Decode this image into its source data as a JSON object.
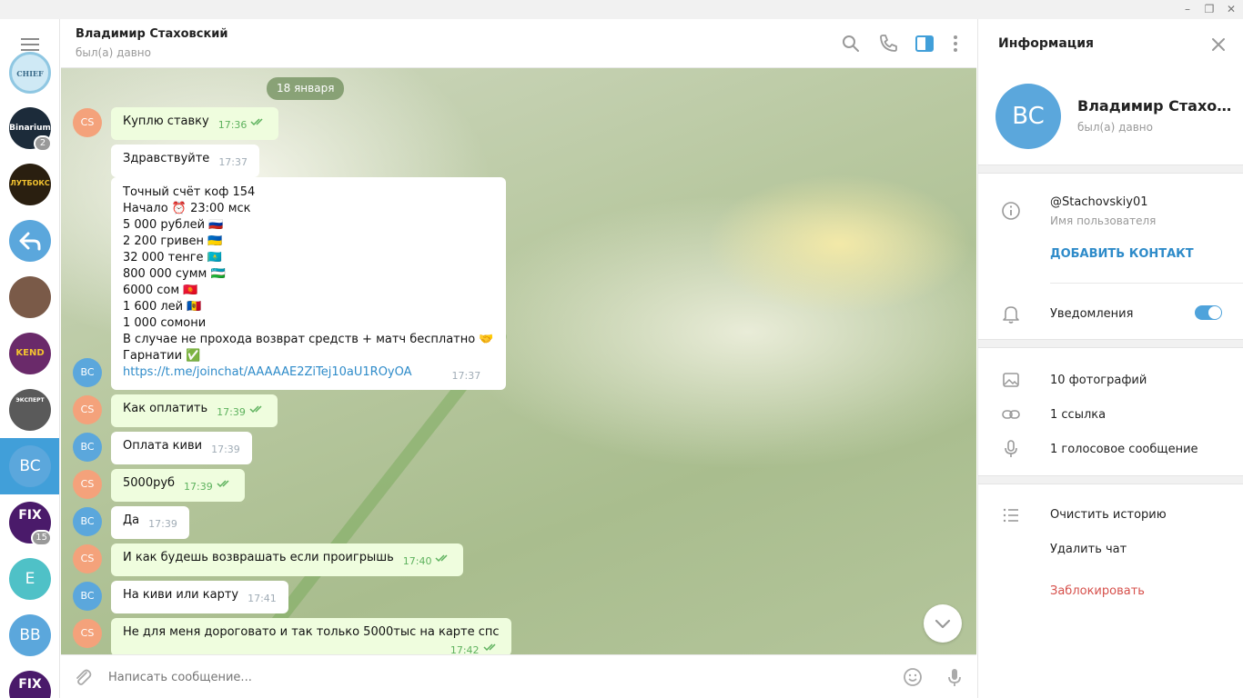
{
  "window": {
    "minimize": "–",
    "maximize": "❐",
    "close": "✕"
  },
  "rail": {
    "items": [
      {
        "name": "chief",
        "label": "CHIEF",
        "color": "#cfe9f5",
        "badge": ""
      },
      {
        "name": "binarium",
        "label": "Binarium",
        "color": "#1c2b3a",
        "badge": "2"
      },
      {
        "name": "lutboks",
        "label": "ЛУТБОКС",
        "color": "#2a1f10",
        "badge": ""
      },
      {
        "name": "reply",
        "label": "",
        "color": "#5ba7dc",
        "badge": ""
      },
      {
        "name": "photo-channel",
        "label": "",
        "color": "#7a5a48",
        "badge": ""
      },
      {
        "name": "kend",
        "label": "KEND",
        "color": "#6a2a6a",
        "badge": ""
      },
      {
        "name": "mexcept",
        "label": "ЭКСПЕРТ",
        "color": "#5a5a5a",
        "badge": ""
      },
      {
        "name": "bc",
        "label": "BC",
        "color": "#5ba7dc",
        "badge": ""
      },
      {
        "name": "fix-matches",
        "label": "FIX",
        "color": "#4a1a6a",
        "badge": "15"
      },
      {
        "name": "e",
        "label": "E",
        "color": "#4fc1c7",
        "badge": ""
      },
      {
        "name": "bb",
        "label": "BB",
        "color": "#5ba7dc",
        "badge": ""
      },
      {
        "name": "fix-matches-2",
        "label": "FIX",
        "color": "#4a1a6a",
        "badge": ""
      }
    ]
  },
  "chat": {
    "name": "Владимир Стаховский",
    "status": "был(а) давно",
    "date": "18 января",
    "composer_placeholder": "Написать сообщение...",
    "messages": [
      {
        "dir": "out",
        "avatar": "CS",
        "text": "Куплю ставку",
        "time": "17:36",
        "read": true
      },
      {
        "dir": "in",
        "avatar": "",
        "text": "Здравствуйте",
        "time": "17:37"
      },
      {
        "dir": "in",
        "avatar": "BC",
        "lines": [
          "Точный счёт коф 154",
          "Начало ⏰ 23:00 мск",
          "5 000 рублей 🇷🇺",
          "2 200 гривен 🇺🇦",
          "32 000 тенге 🇰🇿",
          "800 000 сумм 🇺🇿",
          "6000  сом 🇰🇬",
          "1 600 лей 🇲🇩",
          "1 000  сомони",
          "В случае не прохода возврат средств + матч бесплатно 🤝",
          "Гарнатии ✅"
        ],
        "link": "https://t.me/joinchat/AAAAAE2ZiTej10aU1ROyOA",
        "time": "17:37"
      },
      {
        "dir": "out",
        "avatar": "CS",
        "text": "Как оплатить",
        "time": "17:39",
        "read": true
      },
      {
        "dir": "in",
        "avatar": "BC",
        "text": "Оплата киви",
        "time": "17:39"
      },
      {
        "dir": "out",
        "avatar": "CS",
        "text": "5000руб",
        "time": "17:39",
        "read": true
      },
      {
        "dir": "in",
        "avatar": "BC",
        "text": "Да",
        "time": "17:39"
      },
      {
        "dir": "out",
        "avatar": "CS",
        "text": "И как будешь возврашать если проигрышь",
        "time": "17:40",
        "read": true
      },
      {
        "dir": "in",
        "avatar": "BC",
        "text": "На киви или карту",
        "time": "17:41"
      },
      {
        "dir": "out",
        "avatar": "CS",
        "text": "Не для меня дороговато и так только 5000тыс на карте спс",
        "time": "17:42",
        "read": true
      }
    ]
  },
  "info": {
    "title": "Информация",
    "avatar": "BC",
    "name": "Владимир Стахов…",
    "status": "был(а) давно",
    "username": "@Stachovskiy01",
    "username_label": "Имя пользователя",
    "add_contact": "ДОБАВИТЬ КОНТАКТ",
    "notifications": "Уведомления",
    "notifications_on": true,
    "photos": "10 фотографий",
    "links": "1 ссылка",
    "voice": "1 голосовое сообщение",
    "clear_history": "Очистить историю",
    "delete_chat": "Удалить чат",
    "block": "Заблокировать"
  },
  "colors": {
    "accent": "#419fd9",
    "outgoing_bubble": "#effdde",
    "danger": "#d6504b"
  }
}
